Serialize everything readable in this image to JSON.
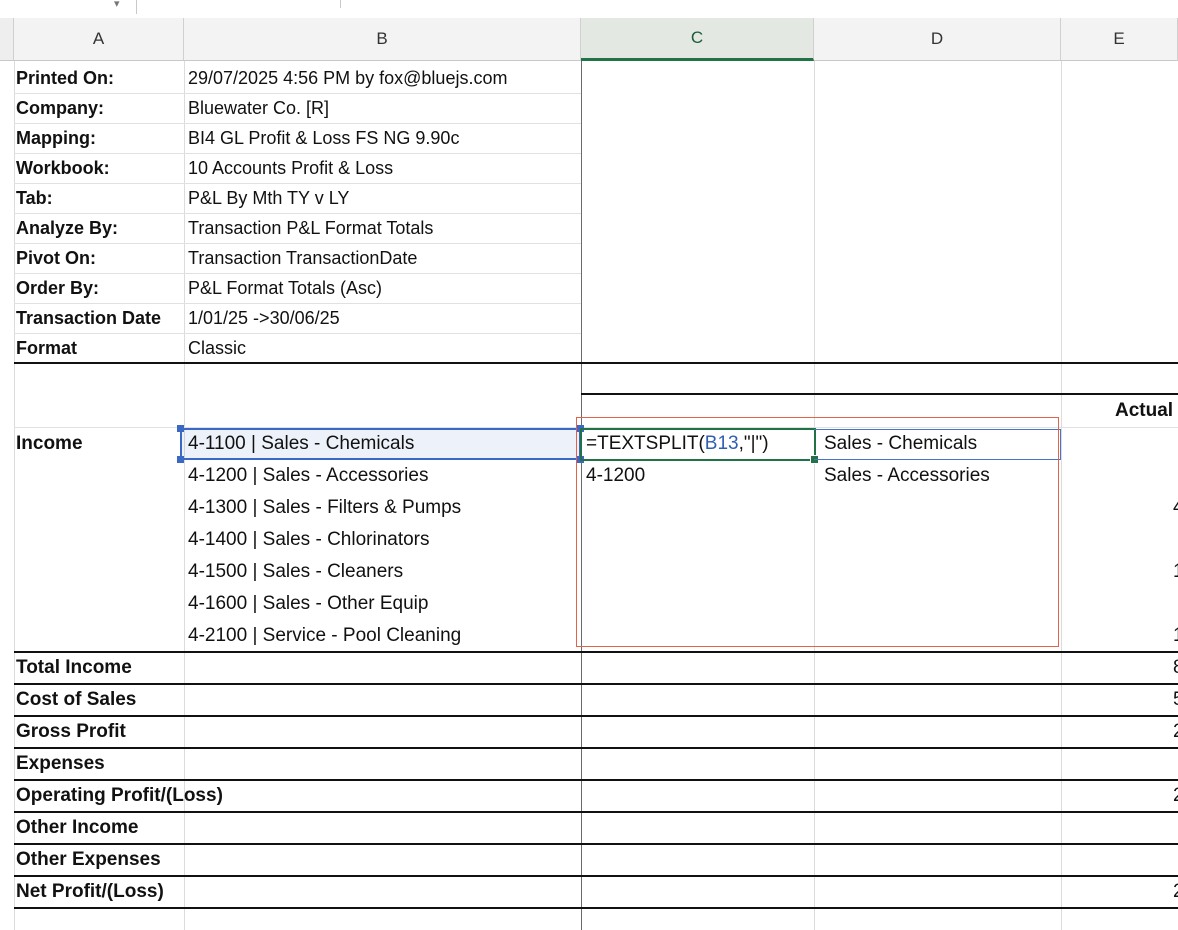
{
  "columns": [
    "A",
    "B",
    "C",
    "D",
    "E"
  ],
  "selected_column": "C",
  "header_block": [
    {
      "label": "Printed On:",
      "value": "29/07/2025 4:56 PM by fox@bluejs.com"
    },
    {
      "label": "Company:",
      "value": "Bluewater Co. [R]"
    },
    {
      "label": "Mapping:",
      "value": "BI4 GL Profit & Loss FS NG 9.90c"
    },
    {
      "label": "Workbook:",
      "value": "10 Accounts Profit & Loss"
    },
    {
      "label": "Tab:",
      "value": "P&L By Mth TY v LY"
    },
    {
      "label": "Analyze By:",
      "value": "Transaction P&L Format Totals"
    },
    {
      "label": "Pivot On:",
      "value": "Transaction TransactionDate"
    },
    {
      "label": "Order By:",
      "value": "P&L Format Totals (Asc)"
    },
    {
      "label": "Transaction Date",
      "value": "1/01/25 ->30/06/25"
    },
    {
      "label": "Format",
      "value": "Classic"
    }
  ],
  "actual_header": "Actual",
  "income_label": "Income",
  "income_accounts": [
    "4-1100 | Sales - Chemicals",
    "4-1200 | Sales - Accessories",
    "4-1300 | Sales - Filters & Pumps",
    "4-1400 | Sales - Chlorinators",
    "4-1500 | Sales - Cleaners",
    "4-1600 | Sales - Other Equip",
    "4-2100 | Service - Pool Cleaning"
  ],
  "formula": {
    "prefix": "=TEXTSPLIT(",
    "ref": "B13",
    "suffix": ",\"|\")"
  },
  "split_results": [
    {
      "code": "",
      "name": "Sales - Chemicals"
    },
    {
      "code": "4-1200",
      "name": "Sales - Accessories"
    }
  ],
  "partial_values": [
    "4",
    "1",
    "1",
    "8",
    "5",
    "2",
    "2",
    "2"
  ],
  "summary_rows": [
    "Total Income",
    "Cost of Sales",
    "Gross Profit",
    "Expenses",
    "Operating Profit/(Loss)",
    "Other Income",
    "Other Expenses",
    "Net Profit/(Loss)"
  ]
}
